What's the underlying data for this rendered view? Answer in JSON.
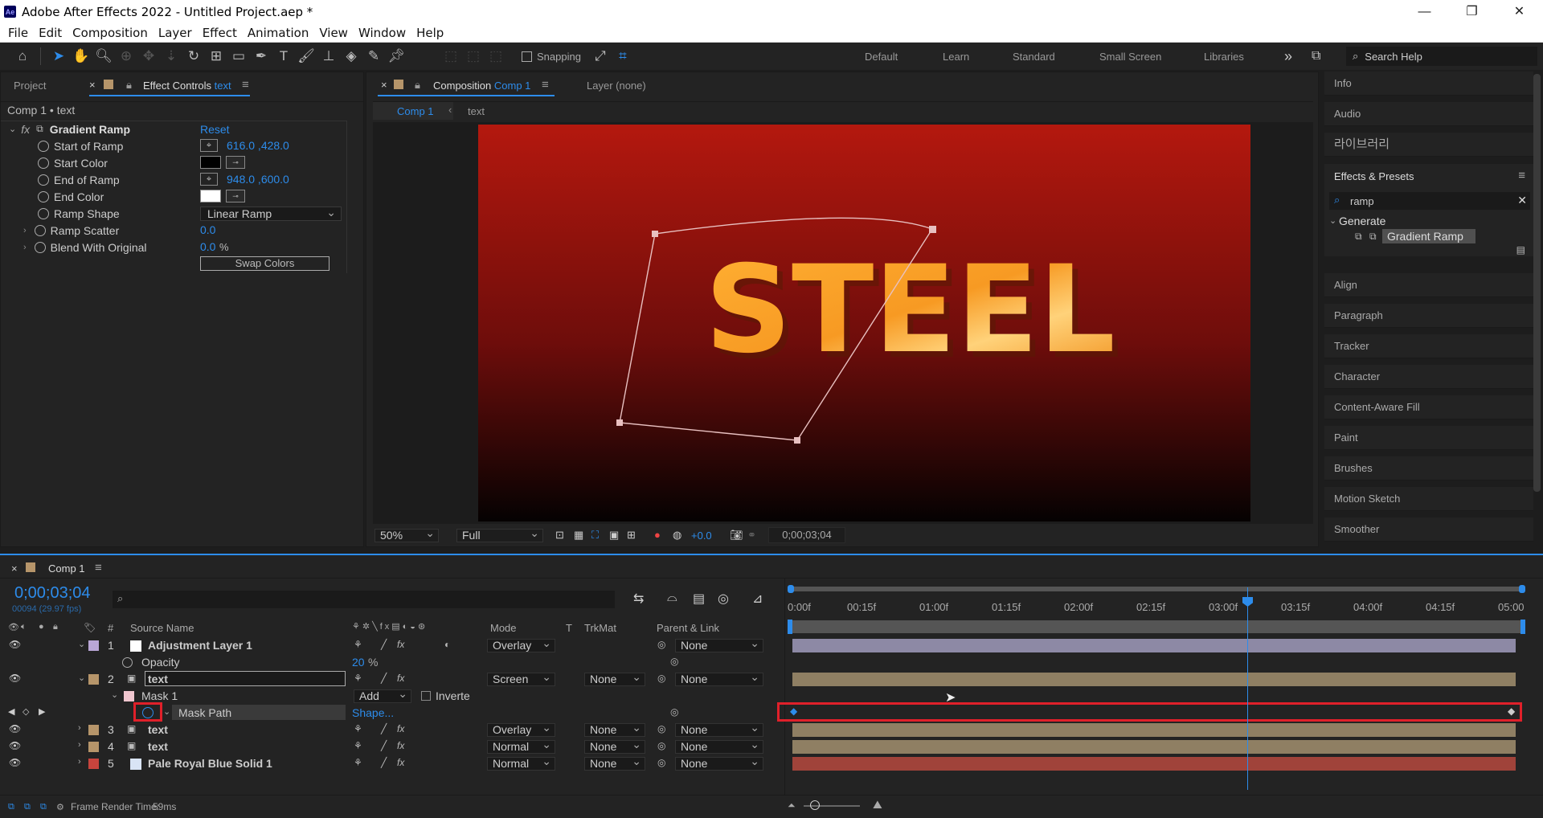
{
  "window": {
    "app_icon": "Ae",
    "title": "Adobe After Effects 2022 - Untitled Project.aep *",
    "minimize": "—",
    "maximize": "❐",
    "close": "✕"
  },
  "menu": [
    "File",
    "Edit",
    "Composition",
    "Layer",
    "Effect",
    "Animation",
    "View",
    "Window",
    "Help"
  ],
  "toolbar": {
    "snapping_label": "Snapping",
    "workspaces": [
      "Default",
      "Learn",
      "Standard",
      "Small Screen",
      "Libraries"
    ],
    "more": "»",
    "search_placeholder": "Search Help"
  },
  "left_panel": {
    "tab_project": "Project",
    "tab_effect_controls": "Effect Controls",
    "tab_effect_target": "text",
    "breadcrumb": "Comp 1 • text",
    "effect_name": "Gradient Ramp",
    "reset": "Reset",
    "props": [
      {
        "name": "Start of Ramp",
        "value": "616.0 ,428.0"
      },
      {
        "name": "Start Color",
        "value": ""
      },
      {
        "name": "End of Ramp",
        "value": "948.0 ,600.0"
      },
      {
        "name": "End Color",
        "value": ""
      },
      {
        "name": "Ramp Shape",
        "value": "Linear Ramp"
      },
      {
        "name": "Ramp Scatter",
        "value": "0.0"
      },
      {
        "name": "Blend With Original",
        "value": "0.0"
      }
    ],
    "blend_unit": "%",
    "swap_colors": "Swap Colors",
    "colors": {
      "start": "#000000",
      "end": "#ffffff"
    }
  },
  "comp_panel": {
    "tab_label": "Composition",
    "tab_comp": "Comp 1",
    "layer_label": "Layer (none)",
    "crumb_comp": "Comp 1",
    "crumb_layer": "text",
    "viewer_text": "STEEL",
    "zoom": "50%",
    "resolution": "Full",
    "exposure": "+0.0",
    "timecode": "0;00;03;04"
  },
  "right_panel": {
    "items_top": [
      "Info",
      "Audio",
      "라이브러리"
    ],
    "effects_presets": "Effects & Presets",
    "search_value": "ramp",
    "category": "Generate",
    "result": "Gradient Ramp",
    "items_bottom": [
      "Align",
      "Paragraph",
      "Tracker",
      "Character",
      "Content-Aware Fill",
      "Paint",
      "Brushes",
      "Motion Sketch",
      "Smoother"
    ]
  },
  "timeline": {
    "tab": "Comp 1",
    "timecode": "0;00;03;04",
    "frame_info": "00094 (29.97 fps)",
    "headers": {
      "num": "#",
      "source": "Source Name",
      "mode": "Mode",
      "t": "T",
      "trkmat": "TrkMat",
      "parent": "Parent & Link"
    },
    "ruler": [
      "0:00f",
      "00:15f",
      "01:00f",
      "01:15f",
      "02:00f",
      "02:15f",
      "03:00f",
      "03:15f",
      "04:00f",
      "04:15f",
      "05:00"
    ],
    "layers": [
      {
        "num": "1",
        "name": "Adjustment Layer 1",
        "mode": "Overlay",
        "trkmat": "",
        "parent": "None",
        "color": "#b9a6d6"
      },
      {
        "num": "2",
        "name": "text",
        "mode": "Screen",
        "trkmat": "None",
        "parent": "None",
        "color": "#b6956a"
      },
      {
        "num": "3",
        "name": "text",
        "mode": "Overlay",
        "trkmat": "None",
        "parent": "None",
        "color": "#b6956a"
      },
      {
        "num": "4",
        "name": "text",
        "mode": "Normal",
        "trkmat": "None",
        "parent": "None",
        "color": "#b6956a"
      },
      {
        "num": "5",
        "name": "Pale Royal Blue Solid 1",
        "mode": "Normal",
        "trkmat": "None",
        "parent": "None",
        "color": "#c8443d"
      }
    ],
    "opacity": {
      "label": "Opacity",
      "value": "20",
      "unit": "%"
    },
    "mask": {
      "name": "Mask 1",
      "mode": "Add",
      "inverted": "Inverte"
    },
    "mask_path": {
      "label": "Mask Path",
      "value": "Shape..."
    },
    "status": {
      "label": "Frame Render Time:",
      "value": "59ms"
    }
  }
}
